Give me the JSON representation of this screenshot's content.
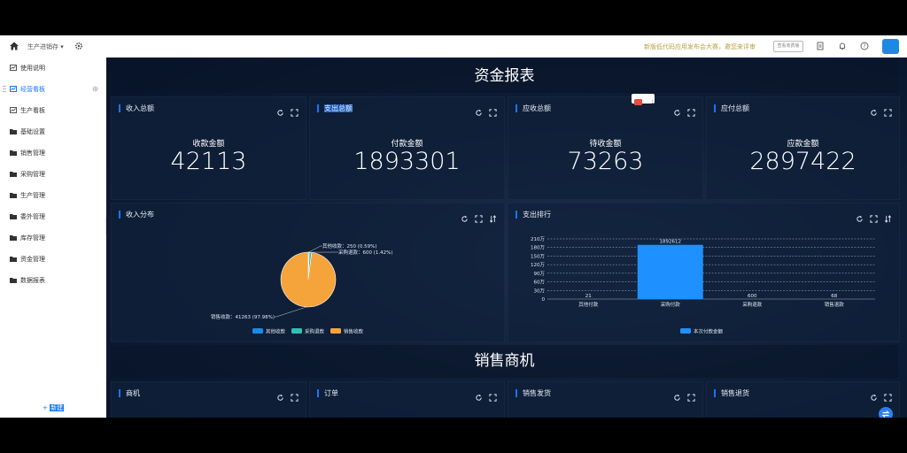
{
  "topbar": {
    "project_label": "生产进销存",
    "notice": "新版低代码应用发布会大赛，邀您来评审",
    "plan_button": "查看收费版"
  },
  "sidebar": {
    "items": [
      {
        "label": "使用说明",
        "icon": "chart-icon"
      },
      {
        "label": "经营看板",
        "icon": "chart-icon",
        "active": true
      },
      {
        "label": "生产看板",
        "icon": "chart-icon"
      },
      {
        "label": "基础设置",
        "icon": "folder-icon"
      },
      {
        "label": "销售管理",
        "icon": "folder-icon"
      },
      {
        "label": "采购管理",
        "icon": "folder-icon"
      },
      {
        "label": "生产管理",
        "icon": "folder-icon"
      },
      {
        "label": "委外管理",
        "icon": "folder-icon"
      },
      {
        "label": "库存管理",
        "icon": "folder-icon"
      },
      {
        "label": "资金管理",
        "icon": "folder-icon"
      },
      {
        "label": "数据报表",
        "icon": "folder-icon"
      }
    ],
    "new_prefix": "+",
    "new_label": "新建"
  },
  "finance": {
    "title": "资金报表",
    "kpis": [
      {
        "panel": "收入总额",
        "label": "收款金额",
        "value": "42113"
      },
      {
        "panel": "支出总额",
        "label": "付款金额",
        "value": "1893301"
      },
      {
        "panel": "应收总额",
        "label": "待收金额",
        "value": "73263"
      },
      {
        "panel": "应付总额",
        "label": "应款金额",
        "value": "2897422"
      }
    ],
    "income_panel_title": "收入分布",
    "expense_panel_title": "支出排行"
  },
  "sales": {
    "title": "销售商机",
    "panels": [
      "商机",
      "订单",
      "销售发货",
      "销售退货"
    ]
  },
  "colors": {
    "accent": "#1677ff",
    "pie_orange": "#f5a33b",
    "pie_blue": "#1e88e5",
    "pie_teal": "#2fbfb3",
    "bar_blue": "#1e90ff"
  },
  "chart_data": [
    {
      "type": "pie",
      "title": "收入分布",
      "categories": [
        "其他收款",
        "采购退款",
        "销售收款"
      ],
      "values": [
        250,
        600,
        41263
      ],
      "labels": [
        "其他收款：250 (0.59%)",
        "采购退款：600 (1.42%)",
        "销售收款：41263 (97.98%)"
      ],
      "legend": [
        "其他收款",
        "采购退款",
        "销售收款"
      ],
      "legend_position": "bottom"
    },
    {
      "type": "bar",
      "title": "支出排行",
      "categories": [
        "其他付款",
        "采购付款",
        "采购退款",
        "销售退款"
      ],
      "series": [
        {
          "name": "本次付款金额",
          "values": [
            21,
            1892612,
            600,
            68
          ]
        }
      ],
      "data_labels": [
        "21",
        "1892612",
        "600",
        "68"
      ],
      "yticks": [
        "0",
        "30万",
        "60万",
        "90万",
        "120万",
        "150万",
        "180万",
        "210万"
      ],
      "ylim": [
        0,
        2100000
      ],
      "grid": true,
      "legend_position": "bottom"
    }
  ]
}
